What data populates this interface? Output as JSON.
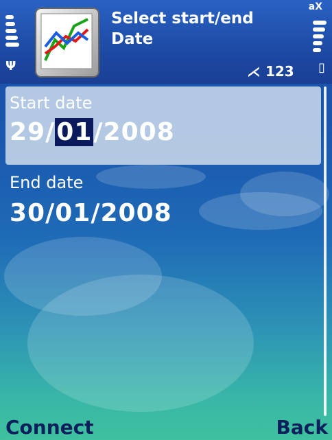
{
  "status": {
    "title_line1": "Select start/end",
    "title_line2": "Date",
    "input_mode": "123",
    "network_indicator": "aX",
    "antenna_glyph": "Ψ",
    "battery_glyph": "▯"
  },
  "form": {
    "start_label": "Start date",
    "start_day": "29",
    "start_month": "01",
    "start_year": "2008",
    "end_label": "End date",
    "end_value": "30/01/2008"
  },
  "softkeys": {
    "left": "Connect",
    "right": "Back"
  },
  "colors": {
    "accent": "#1d4fa3",
    "selection": "#0b1a5c",
    "softkey_text": "#0b1f5a"
  }
}
